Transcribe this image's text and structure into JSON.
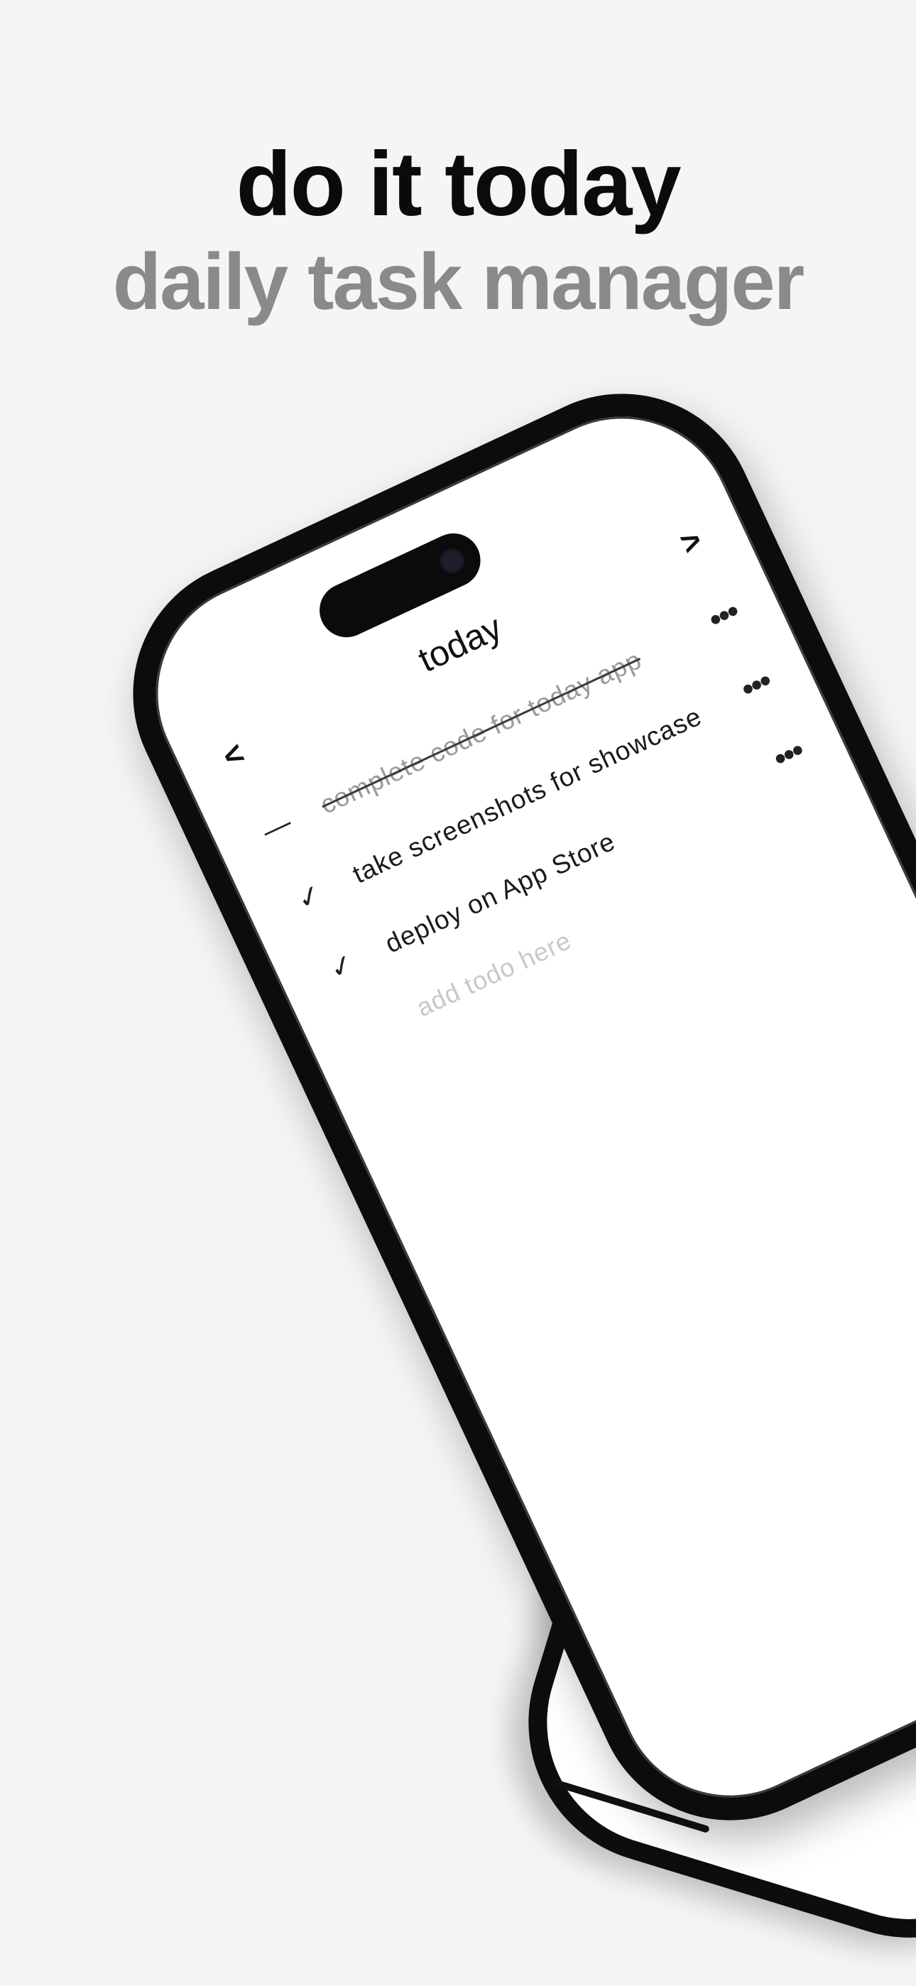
{
  "header": {
    "title": "do it today",
    "subtitle": "daily task manager"
  },
  "app": {
    "screen_title": "today",
    "nav_prev": "<",
    "nav_next": ">",
    "more_glyph": "•••",
    "todos": [
      {
        "text": "complete code for today app",
        "status_glyph": "—",
        "done": true
      },
      {
        "text": "take screenshots for showcase",
        "status_glyph": "✓",
        "done": false
      },
      {
        "text": "deploy on App Store",
        "status_glyph": "✓",
        "done": false
      }
    ],
    "input": {
      "placeholder": "add todo here",
      "value": ""
    }
  },
  "colors": {
    "background": "#f5f5f5",
    "title": "#0b0b0b",
    "subtitle": "#8a8a8a",
    "done_text": "#9a9a9a",
    "placeholder": "#c8c8c8",
    "phone_frame": "#0c0c0c"
  },
  "icons": {
    "prev": "chevron-left-icon",
    "next": "chevron-right-icon",
    "more": "more-dots-icon",
    "check": "checkmark-icon",
    "dash": "dash-icon"
  }
}
